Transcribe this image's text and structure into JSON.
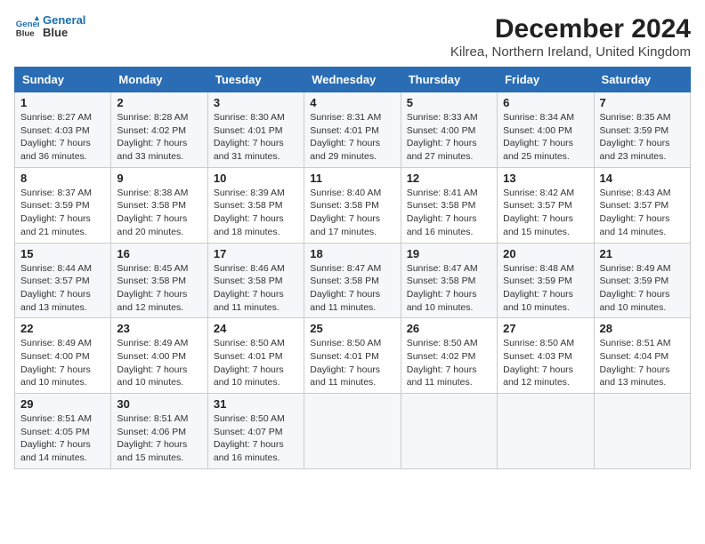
{
  "header": {
    "logo_line1": "General",
    "logo_line2": "Blue",
    "title": "December 2024",
    "subtitle": "Kilrea, Northern Ireland, United Kingdom"
  },
  "days_of_week": [
    "Sunday",
    "Monday",
    "Tuesday",
    "Wednesday",
    "Thursday",
    "Friday",
    "Saturday"
  ],
  "weeks": [
    [
      {
        "day": "1",
        "text": "Sunrise: 8:27 AM\nSunset: 4:03 PM\nDaylight: 7 hours and 36 minutes."
      },
      {
        "day": "2",
        "text": "Sunrise: 8:28 AM\nSunset: 4:02 PM\nDaylight: 7 hours and 33 minutes."
      },
      {
        "day": "3",
        "text": "Sunrise: 8:30 AM\nSunset: 4:01 PM\nDaylight: 7 hours and 31 minutes."
      },
      {
        "day": "4",
        "text": "Sunrise: 8:31 AM\nSunset: 4:01 PM\nDaylight: 7 hours and 29 minutes."
      },
      {
        "day": "5",
        "text": "Sunrise: 8:33 AM\nSunset: 4:00 PM\nDaylight: 7 hours and 27 minutes."
      },
      {
        "day": "6",
        "text": "Sunrise: 8:34 AM\nSunset: 4:00 PM\nDaylight: 7 hours and 25 minutes."
      },
      {
        "day": "7",
        "text": "Sunrise: 8:35 AM\nSunset: 3:59 PM\nDaylight: 7 hours and 23 minutes."
      }
    ],
    [
      {
        "day": "8",
        "text": "Sunrise: 8:37 AM\nSunset: 3:59 PM\nDaylight: 7 hours and 21 minutes."
      },
      {
        "day": "9",
        "text": "Sunrise: 8:38 AM\nSunset: 3:58 PM\nDaylight: 7 hours and 20 minutes."
      },
      {
        "day": "10",
        "text": "Sunrise: 8:39 AM\nSunset: 3:58 PM\nDaylight: 7 hours and 18 minutes."
      },
      {
        "day": "11",
        "text": "Sunrise: 8:40 AM\nSunset: 3:58 PM\nDaylight: 7 hours and 17 minutes."
      },
      {
        "day": "12",
        "text": "Sunrise: 8:41 AM\nSunset: 3:58 PM\nDaylight: 7 hours and 16 minutes."
      },
      {
        "day": "13",
        "text": "Sunrise: 8:42 AM\nSunset: 3:57 PM\nDaylight: 7 hours and 15 minutes."
      },
      {
        "day": "14",
        "text": "Sunrise: 8:43 AM\nSunset: 3:57 PM\nDaylight: 7 hours and 14 minutes."
      }
    ],
    [
      {
        "day": "15",
        "text": "Sunrise: 8:44 AM\nSunset: 3:57 PM\nDaylight: 7 hours and 13 minutes."
      },
      {
        "day": "16",
        "text": "Sunrise: 8:45 AM\nSunset: 3:58 PM\nDaylight: 7 hours and 12 minutes."
      },
      {
        "day": "17",
        "text": "Sunrise: 8:46 AM\nSunset: 3:58 PM\nDaylight: 7 hours and 11 minutes."
      },
      {
        "day": "18",
        "text": "Sunrise: 8:47 AM\nSunset: 3:58 PM\nDaylight: 7 hours and 11 minutes."
      },
      {
        "day": "19",
        "text": "Sunrise: 8:47 AM\nSunset: 3:58 PM\nDaylight: 7 hours and 10 minutes."
      },
      {
        "day": "20",
        "text": "Sunrise: 8:48 AM\nSunset: 3:59 PM\nDaylight: 7 hours and 10 minutes."
      },
      {
        "day": "21",
        "text": "Sunrise: 8:49 AM\nSunset: 3:59 PM\nDaylight: 7 hours and 10 minutes."
      }
    ],
    [
      {
        "day": "22",
        "text": "Sunrise: 8:49 AM\nSunset: 4:00 PM\nDaylight: 7 hours and 10 minutes."
      },
      {
        "day": "23",
        "text": "Sunrise: 8:49 AM\nSunset: 4:00 PM\nDaylight: 7 hours and 10 minutes."
      },
      {
        "day": "24",
        "text": "Sunrise: 8:50 AM\nSunset: 4:01 PM\nDaylight: 7 hours and 10 minutes."
      },
      {
        "day": "25",
        "text": "Sunrise: 8:50 AM\nSunset: 4:01 PM\nDaylight: 7 hours and 11 minutes."
      },
      {
        "day": "26",
        "text": "Sunrise: 8:50 AM\nSunset: 4:02 PM\nDaylight: 7 hours and 11 minutes."
      },
      {
        "day": "27",
        "text": "Sunrise: 8:50 AM\nSunset: 4:03 PM\nDaylight: 7 hours and 12 minutes."
      },
      {
        "day": "28",
        "text": "Sunrise: 8:51 AM\nSunset: 4:04 PM\nDaylight: 7 hours and 13 minutes."
      }
    ],
    [
      {
        "day": "29",
        "text": "Sunrise: 8:51 AM\nSunset: 4:05 PM\nDaylight: 7 hours and 14 minutes."
      },
      {
        "day": "30",
        "text": "Sunrise: 8:51 AM\nSunset: 4:06 PM\nDaylight: 7 hours and 15 minutes."
      },
      {
        "day": "31",
        "text": "Sunrise: 8:50 AM\nSunset: 4:07 PM\nDaylight: 7 hours and 16 minutes."
      },
      {
        "day": "",
        "text": ""
      },
      {
        "day": "",
        "text": ""
      },
      {
        "day": "",
        "text": ""
      },
      {
        "day": "",
        "text": ""
      }
    ]
  ]
}
